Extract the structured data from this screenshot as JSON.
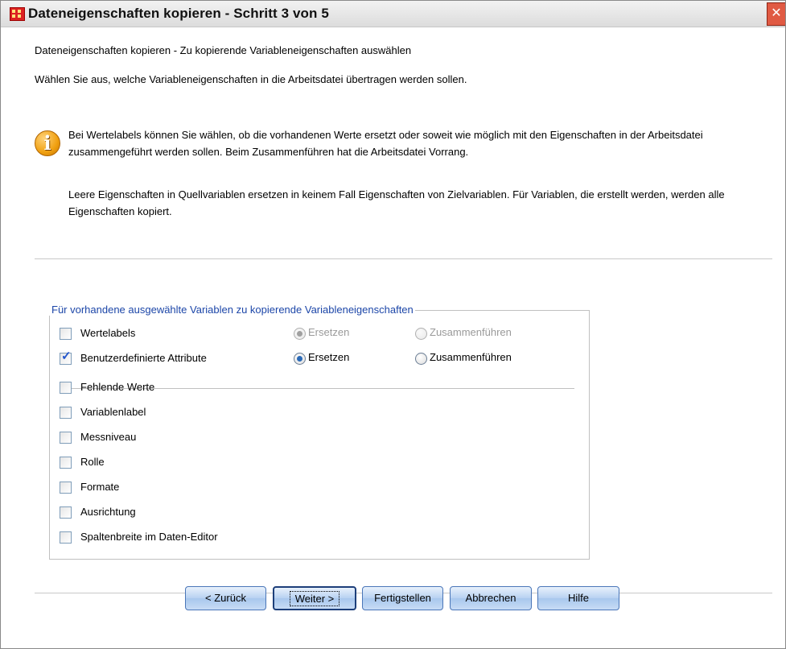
{
  "window": {
    "title": "Dateneigenschaften kopieren - Schritt 3 von 5",
    "close_glyph": "✕"
  },
  "content": {
    "heading": "Dateneigenschaften kopieren - Zu kopierende Variableneigenschaften auswählen",
    "subheading": "Wählen Sie aus, welche Variableneigenschaften in die Arbeitsdatei übertragen werden sollen.",
    "info_text": "Bei Wertelabels können Sie wählen, ob die vorhandenen Werte ersetzt oder soweit wie möglich mit den Eigenschaften in der Arbeitsdatei zusammengeführt werden sollen. Beim Zusammenführen hat die Arbeitsdatei Vorrang.",
    "note_text": "Leere Eigenschaften in Quellvariablen ersetzen in keinem Fall Eigenschaften von Zielvariablen. Für Variablen, die erstellt werden, werden alle Eigenschaften kopiert.",
    "info_icon_glyph": "i"
  },
  "group": {
    "legend": "Für vorhandene ausgewählte Variablen zu kopierende Variableneigenschaften",
    "check_glyph": "✓",
    "options": [
      {
        "label": "Wertelabels",
        "checked": false
      },
      {
        "label": "Benutzerdefinierte Attribute",
        "checked": true
      },
      {
        "label": "Fehlende Werte",
        "checked": false
      },
      {
        "label": "Variablenlabel",
        "checked": false
      },
      {
        "label": "Messniveau",
        "checked": false
      },
      {
        "label": "Rolle",
        "checked": false
      },
      {
        "label": "Formate",
        "checked": false
      },
      {
        "label": "Ausrichtung",
        "checked": false
      },
      {
        "label": "Spaltenbreite im Daten-Editor",
        "checked": false
      }
    ],
    "wertelabels_radios": {
      "replace_label": "Ersetzen",
      "merge_label": "Zusammenführen",
      "selected": "replace",
      "enabled": false
    },
    "attributes_radios": {
      "replace_label": "Ersetzen",
      "merge_label": "Zusammenführen",
      "selected": "replace",
      "enabled": true
    }
  },
  "buttons": {
    "back": "< Zurück",
    "next": "Weiter >",
    "finish": "Fertigstellen",
    "cancel": "Abbrechen",
    "help": "Hilfe"
  }
}
